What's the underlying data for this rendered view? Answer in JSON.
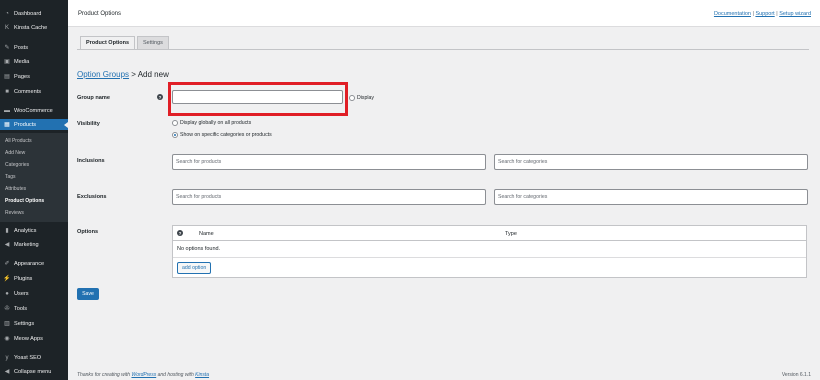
{
  "sidebar": {
    "items": [
      {
        "label": "Dashboard",
        "icon": "dashboard-icon"
      },
      {
        "label": "Kinsta Cache",
        "icon": "kinsta-icon"
      },
      {
        "label": "Posts",
        "icon": "pin-icon"
      },
      {
        "label": "Media",
        "icon": "media-icon"
      },
      {
        "label": "Pages",
        "icon": "page-icon"
      },
      {
        "label": "Comments",
        "icon": "comment-icon"
      },
      {
        "label": "WooCommerce",
        "icon": "woocommerce-icon"
      },
      {
        "label": "Products",
        "icon": "products-icon"
      },
      {
        "label": "Analytics",
        "icon": "analytics-icon"
      },
      {
        "label": "Marketing",
        "icon": "megaphone-icon"
      },
      {
        "label": "Appearance",
        "icon": "brush-icon"
      },
      {
        "label": "Plugins",
        "icon": "plugin-icon"
      },
      {
        "label": "Users",
        "icon": "user-icon"
      },
      {
        "label": "Tools",
        "icon": "wrench-icon"
      },
      {
        "label": "Settings",
        "icon": "settings-icon"
      },
      {
        "label": "Meow Apps",
        "icon": "meow-icon"
      },
      {
        "label": "Yoast SEO",
        "icon": "yoast-icon"
      },
      {
        "label": "Collapse menu",
        "icon": "collapse-icon"
      }
    ],
    "submenu": [
      "All Products",
      "Add New",
      "Categories",
      "Tags",
      "Attributes",
      "Product Options",
      "Reviews"
    ]
  },
  "header": {
    "title": "Product Options",
    "links": {
      "documentation": "Documentation",
      "sep1": " | ",
      "support": "Support",
      "sep2": " | ",
      "setup": "Setup wizard"
    }
  },
  "tabs": {
    "product_options": "Product Options",
    "settings": "Settings"
  },
  "breadcrumb": {
    "link": "Option Groups",
    "separator": " > ",
    "current": "Add new"
  },
  "form": {
    "group_name": {
      "label": "Group name",
      "value": "",
      "display_label": "Display"
    },
    "visibility": {
      "label": "Visibility",
      "options": [
        "Display globally on all products",
        "Show on specific categories or products"
      ],
      "selected": "Show on specific categories or products"
    },
    "inclusions": {
      "label": "Inclusions",
      "products_placeholder": "Search for products",
      "categories_placeholder": "Search for categories"
    },
    "exclusions": {
      "label": "Exclusions",
      "products_placeholder": "Search for products",
      "categories_placeholder": "Search for categories"
    },
    "options": {
      "label": "Options",
      "columns": [
        "Name",
        "Type"
      ],
      "empty_text": "No options found.",
      "add_label": "add option"
    },
    "save_label": "Save"
  },
  "footer": {
    "prefix": "Thanks for creating with ",
    "wordpress": "WordPress",
    "middle": " and hosting with ",
    "kinsta": "Kinsta",
    "version": "Version 6.1.1"
  },
  "colors": {
    "sidebar": "#1d2327",
    "accent": "#2271b1",
    "highlight": "#e01e26"
  }
}
